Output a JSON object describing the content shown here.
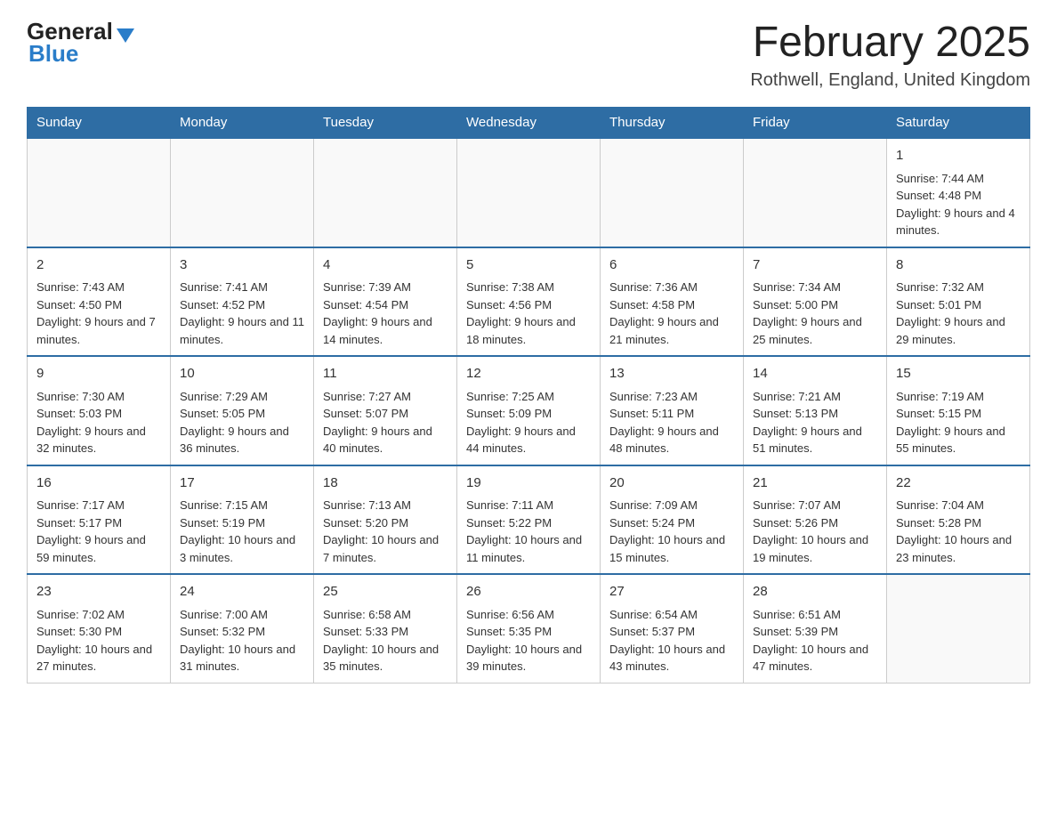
{
  "header": {
    "logo_general": "General",
    "logo_blue": "Blue",
    "title": "February 2025",
    "subtitle": "Rothwell, England, United Kingdom"
  },
  "weekdays": [
    "Sunday",
    "Monday",
    "Tuesday",
    "Wednesday",
    "Thursday",
    "Friday",
    "Saturday"
  ],
  "weeks": [
    [
      {
        "day": "",
        "info": ""
      },
      {
        "day": "",
        "info": ""
      },
      {
        "day": "",
        "info": ""
      },
      {
        "day": "",
        "info": ""
      },
      {
        "day": "",
        "info": ""
      },
      {
        "day": "",
        "info": ""
      },
      {
        "day": "1",
        "info": "Sunrise: 7:44 AM\nSunset: 4:48 PM\nDaylight: 9 hours and 4 minutes."
      }
    ],
    [
      {
        "day": "2",
        "info": "Sunrise: 7:43 AM\nSunset: 4:50 PM\nDaylight: 9 hours and 7 minutes."
      },
      {
        "day": "3",
        "info": "Sunrise: 7:41 AM\nSunset: 4:52 PM\nDaylight: 9 hours and 11 minutes."
      },
      {
        "day": "4",
        "info": "Sunrise: 7:39 AM\nSunset: 4:54 PM\nDaylight: 9 hours and 14 minutes."
      },
      {
        "day": "5",
        "info": "Sunrise: 7:38 AM\nSunset: 4:56 PM\nDaylight: 9 hours and 18 minutes."
      },
      {
        "day": "6",
        "info": "Sunrise: 7:36 AM\nSunset: 4:58 PM\nDaylight: 9 hours and 21 minutes."
      },
      {
        "day": "7",
        "info": "Sunrise: 7:34 AM\nSunset: 5:00 PM\nDaylight: 9 hours and 25 minutes."
      },
      {
        "day": "8",
        "info": "Sunrise: 7:32 AM\nSunset: 5:01 PM\nDaylight: 9 hours and 29 minutes."
      }
    ],
    [
      {
        "day": "9",
        "info": "Sunrise: 7:30 AM\nSunset: 5:03 PM\nDaylight: 9 hours and 32 minutes."
      },
      {
        "day": "10",
        "info": "Sunrise: 7:29 AM\nSunset: 5:05 PM\nDaylight: 9 hours and 36 minutes."
      },
      {
        "day": "11",
        "info": "Sunrise: 7:27 AM\nSunset: 5:07 PM\nDaylight: 9 hours and 40 minutes."
      },
      {
        "day": "12",
        "info": "Sunrise: 7:25 AM\nSunset: 5:09 PM\nDaylight: 9 hours and 44 minutes."
      },
      {
        "day": "13",
        "info": "Sunrise: 7:23 AM\nSunset: 5:11 PM\nDaylight: 9 hours and 48 minutes."
      },
      {
        "day": "14",
        "info": "Sunrise: 7:21 AM\nSunset: 5:13 PM\nDaylight: 9 hours and 51 minutes."
      },
      {
        "day": "15",
        "info": "Sunrise: 7:19 AM\nSunset: 5:15 PM\nDaylight: 9 hours and 55 minutes."
      }
    ],
    [
      {
        "day": "16",
        "info": "Sunrise: 7:17 AM\nSunset: 5:17 PM\nDaylight: 9 hours and 59 minutes."
      },
      {
        "day": "17",
        "info": "Sunrise: 7:15 AM\nSunset: 5:19 PM\nDaylight: 10 hours and 3 minutes."
      },
      {
        "day": "18",
        "info": "Sunrise: 7:13 AM\nSunset: 5:20 PM\nDaylight: 10 hours and 7 minutes."
      },
      {
        "day": "19",
        "info": "Sunrise: 7:11 AM\nSunset: 5:22 PM\nDaylight: 10 hours and 11 minutes."
      },
      {
        "day": "20",
        "info": "Sunrise: 7:09 AM\nSunset: 5:24 PM\nDaylight: 10 hours and 15 minutes."
      },
      {
        "day": "21",
        "info": "Sunrise: 7:07 AM\nSunset: 5:26 PM\nDaylight: 10 hours and 19 minutes."
      },
      {
        "day": "22",
        "info": "Sunrise: 7:04 AM\nSunset: 5:28 PM\nDaylight: 10 hours and 23 minutes."
      }
    ],
    [
      {
        "day": "23",
        "info": "Sunrise: 7:02 AM\nSunset: 5:30 PM\nDaylight: 10 hours and 27 minutes."
      },
      {
        "day": "24",
        "info": "Sunrise: 7:00 AM\nSunset: 5:32 PM\nDaylight: 10 hours and 31 minutes."
      },
      {
        "day": "25",
        "info": "Sunrise: 6:58 AM\nSunset: 5:33 PM\nDaylight: 10 hours and 35 minutes."
      },
      {
        "day": "26",
        "info": "Sunrise: 6:56 AM\nSunset: 5:35 PM\nDaylight: 10 hours and 39 minutes."
      },
      {
        "day": "27",
        "info": "Sunrise: 6:54 AM\nSunset: 5:37 PM\nDaylight: 10 hours and 43 minutes."
      },
      {
        "day": "28",
        "info": "Sunrise: 6:51 AM\nSunset: 5:39 PM\nDaylight: 10 hours and 47 minutes."
      },
      {
        "day": "",
        "info": ""
      }
    ]
  ]
}
